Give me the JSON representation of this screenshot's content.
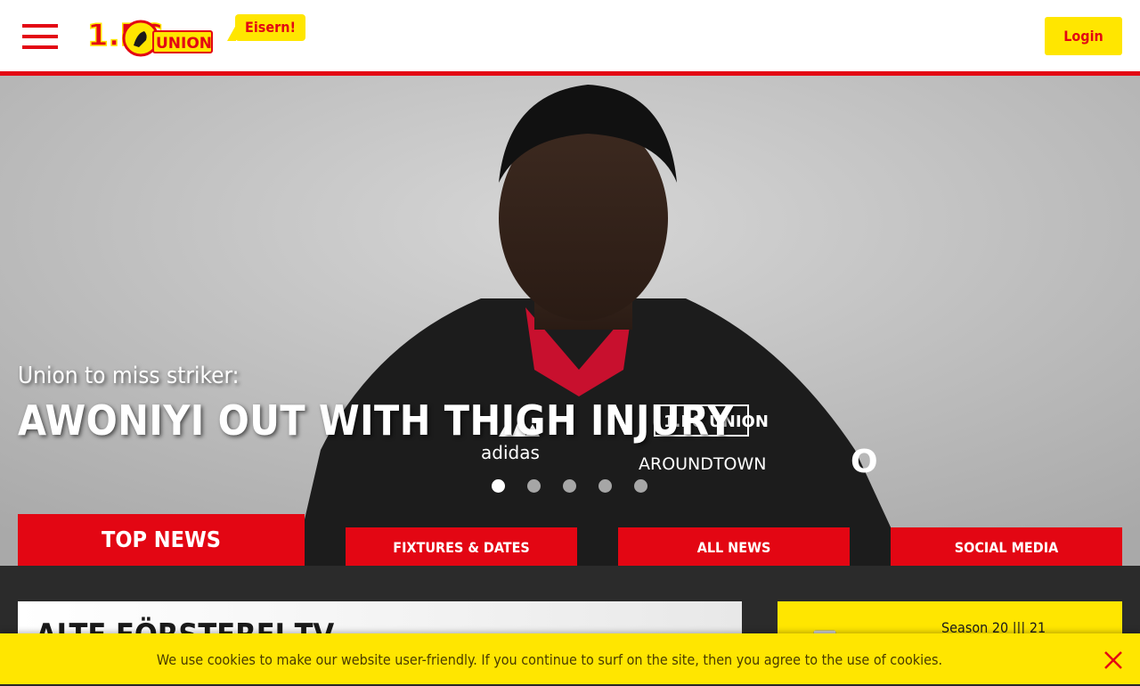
{
  "header": {
    "logo_text": "1.FC UNION",
    "slogan": "Eisern!",
    "login_label": "Login"
  },
  "hero": {
    "subtitle": "Union to miss striker:",
    "title": "AWONIYI OUT WITH THIGH INJURY",
    "slides_count": 5,
    "active_slide": 1,
    "jacket_sponsor": "AROUNDTOWN",
    "jacket_brand": "adidas"
  },
  "tabs": [
    {
      "label": "TOP NEWS"
    },
    {
      "label": "FIXTURES & DATES"
    },
    {
      "label": "ALL NEWS"
    },
    {
      "label": "SOCIAL MEDIA"
    }
  ],
  "lower": {
    "tv_title": "ALTE FÖRSTEREI TV",
    "season_label": "Season 20 ||| 21"
  },
  "cookie": {
    "message": "We use cookies to make our website user-friendly. If you continue to surf on the site, then you agree to the use of cookies."
  },
  "colors": {
    "brand_red": "#e30613",
    "brand_yellow": "#ffe600"
  }
}
